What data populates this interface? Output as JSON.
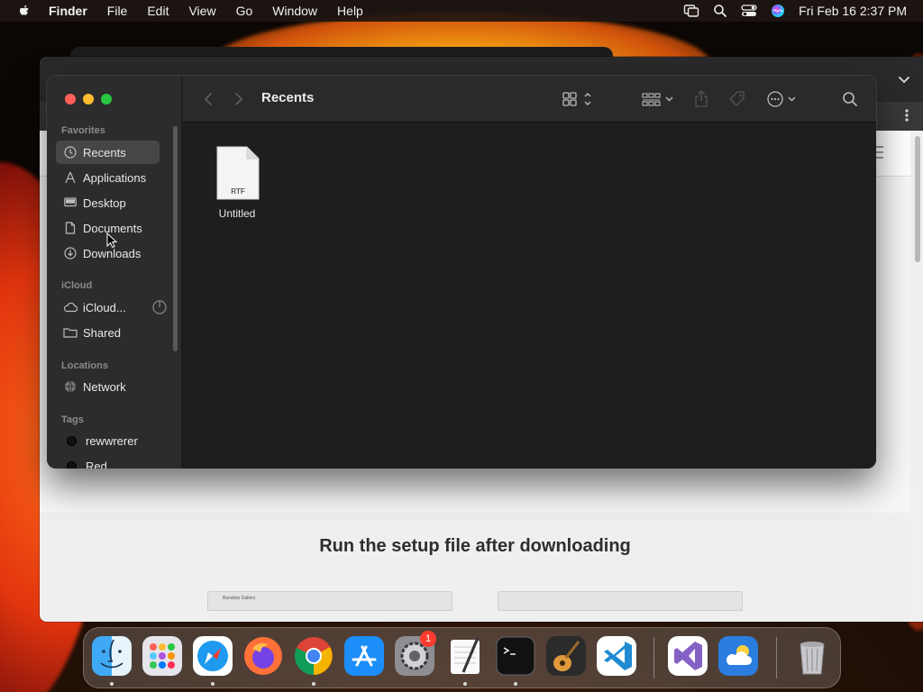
{
  "menubar": {
    "app": "Finder",
    "items": [
      "File",
      "Edit",
      "View",
      "Go",
      "Window",
      "Help"
    ],
    "clock": "Fri Feb 16  2:37 PM",
    "status_icons": [
      "screen-mirroring-icon",
      "spotlight-search-icon",
      "control-center-icon",
      "siri-icon"
    ]
  },
  "finder": {
    "title": "Recents",
    "sidebar": {
      "favorites_header": "Favorites",
      "favorites": [
        {
          "label": "Recents",
          "icon": "clock-icon",
          "selected": true
        },
        {
          "label": "Applications",
          "icon": "applications-icon"
        },
        {
          "label": "Desktop",
          "icon": "desktop-icon"
        },
        {
          "label": "Documents",
          "icon": "document-icon"
        },
        {
          "label": "Downloads",
          "icon": "download-icon"
        }
      ],
      "icloud_header": "iCloud",
      "icloud": [
        {
          "label": "iCloud...",
          "icon": "cloud-icon"
        },
        {
          "label": "Shared",
          "icon": "shared-folder-icon"
        }
      ],
      "locations_header": "Locations",
      "locations": [
        {
          "label": "Network",
          "icon": "globe-icon"
        }
      ],
      "tags_header": "Tags",
      "tags": [
        {
          "label": "rewwrerer",
          "color": "#111111"
        },
        {
          "label": "Red",
          "color": "#111111"
        }
      ]
    },
    "files": [
      {
        "name": "Untitled",
        "type_label": "RTF"
      }
    ]
  },
  "browser_background": {
    "heading": "Run the setup file after downloading",
    "thumb_tab_label": "Bandizip Gallery"
  },
  "dock": {
    "apps": [
      "Finder",
      "Launchpad",
      "Safari",
      "Firefox",
      "Google Chrome",
      "App Store",
      "System Settings",
      "TextEdit",
      "Terminal",
      "GarageBand",
      "Visual Studio Code",
      "Visual Studio",
      "Weather",
      "Trash"
    ],
    "system_settings_badge": "1"
  },
  "colors": {
    "accent_close": "#ff5f57",
    "accent_min": "#febc2e",
    "accent_max": "#28c840",
    "sidebar_bg": "#2c2c2c",
    "content_bg": "#1e1e1e"
  }
}
